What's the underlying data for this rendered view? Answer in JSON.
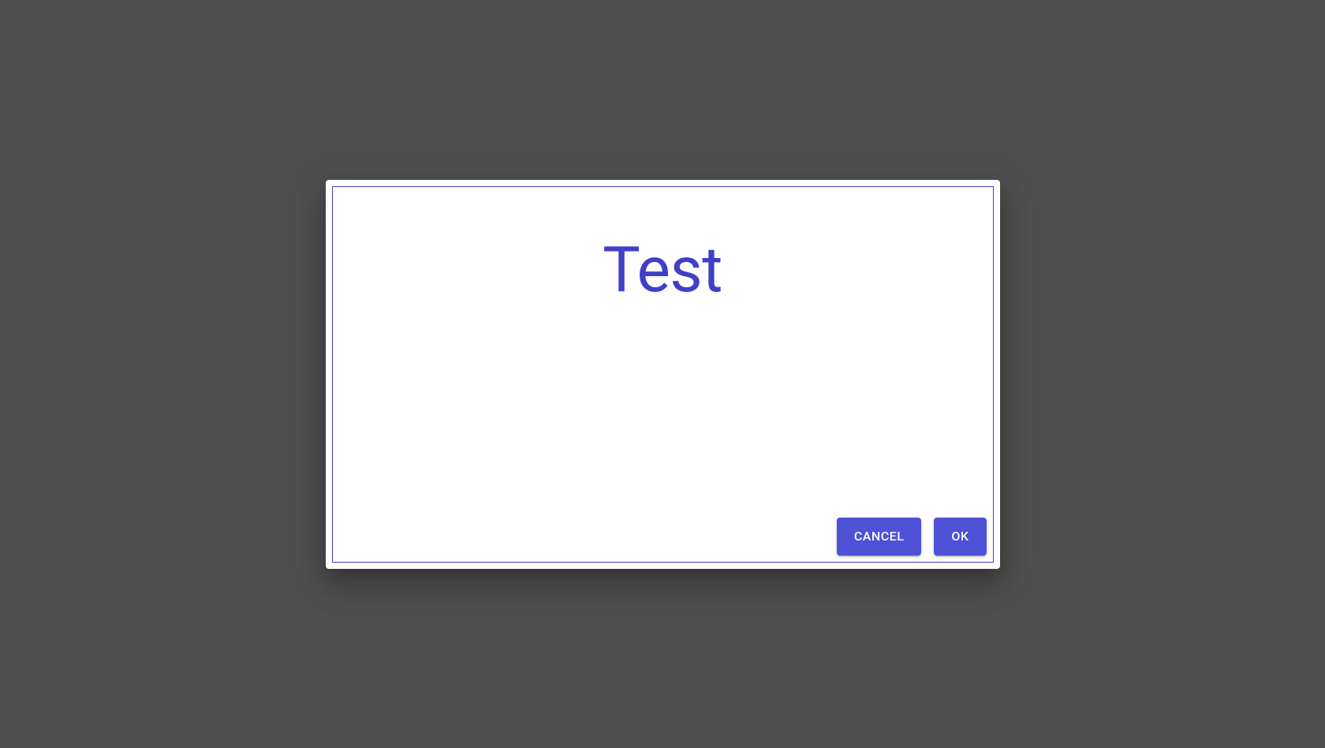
{
  "dialog": {
    "title": "Test",
    "actions": {
      "cancel_label": "CANCEL",
      "ok_label": "OK"
    }
  }
}
